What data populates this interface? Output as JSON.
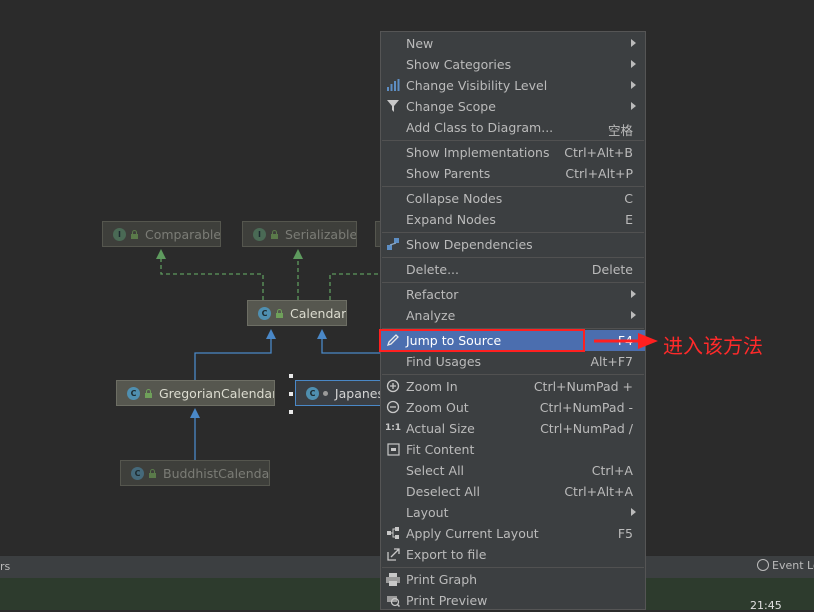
{
  "diagram": {
    "nodes": [
      {
        "id": "comparable",
        "label": "Comparable",
        "kind": "interface",
        "state": "faded"
      },
      {
        "id": "serializable",
        "label": "Serializable",
        "kind": "interface",
        "state": "faded"
      },
      {
        "id": "calendar",
        "label": "Calendar",
        "kind": "abstract-class",
        "state": "normal"
      },
      {
        "id": "gregorian",
        "label": "GregorianCalendar",
        "kind": "class",
        "state": "normal"
      },
      {
        "id": "japanese",
        "label": "Japanes",
        "kind": "class",
        "state": "selected"
      },
      {
        "id": "buddhist",
        "label": "BuddhistCalendar",
        "kind": "class",
        "state": "faded"
      }
    ],
    "colors": {
      "implements_edge": "#5e9a5e",
      "extends_edge": "#4a88c7",
      "background": "#2b2b2b"
    }
  },
  "statusbar": {
    "left_text": "rs",
    "event_log": "Event Lo",
    "clock": "21:45"
  },
  "context_menu": {
    "highlight_color": "#4b6eaf",
    "items": [
      {
        "label": "New",
        "icon": "",
        "submenu": true
      },
      {
        "label": "Show Categories",
        "submenu": true
      },
      {
        "label": "Change Visibility Level",
        "icon": "visibility-icon",
        "submenu": true
      },
      {
        "label": "Change Scope",
        "icon": "filter-icon",
        "submenu": true
      },
      {
        "label": "Add Class to Diagram...",
        "shortcut": "空格"
      },
      {
        "label": "Show Implementations",
        "shortcut": "Ctrl+Alt+B"
      },
      {
        "label": "Show Parents",
        "shortcut": "Ctrl+Alt+P"
      },
      {
        "label": "Collapse Nodes",
        "shortcut": "C"
      },
      {
        "label": "Expand Nodes",
        "shortcut": "E"
      },
      {
        "label": "Show Dependencies",
        "icon": "dependencies-icon"
      },
      {
        "label": "Delete...",
        "shortcut": "Delete"
      },
      {
        "label": "Refactor",
        "submenu": true
      },
      {
        "label": "Analyze",
        "submenu": true
      },
      {
        "label": "Jump to Source",
        "icon": "pencil-icon",
        "shortcut": "F4",
        "highlighted": true
      },
      {
        "label": "Find Usages",
        "shortcut": "Alt+F7"
      },
      {
        "label": "Zoom In",
        "icon": "zoom-in-icon",
        "shortcut": "Ctrl+NumPad +"
      },
      {
        "label": "Zoom Out",
        "icon": "zoom-out-icon",
        "shortcut": "Ctrl+NumPad -"
      },
      {
        "label": "Actual Size",
        "icon": "actual-size-icon",
        "shortcut": "Ctrl+NumPad /"
      },
      {
        "label": "Fit Content",
        "icon": "fit-content-icon"
      },
      {
        "label": "Select All",
        "shortcut": "Ctrl+A"
      },
      {
        "label": "Deselect All",
        "shortcut": "Ctrl+Alt+A"
      },
      {
        "label": "Layout",
        "submenu": true
      },
      {
        "label": "Apply Current Layout",
        "icon": "layout-icon",
        "shortcut": "F5"
      },
      {
        "label": "Export to file",
        "icon": "export-icon"
      },
      {
        "label": "Print Graph",
        "icon": "print-icon"
      },
      {
        "label": "Print Preview",
        "icon": "print-preview-icon"
      }
    ]
  },
  "annotation": {
    "text": "进入该方法",
    "color": "#ff2020"
  }
}
